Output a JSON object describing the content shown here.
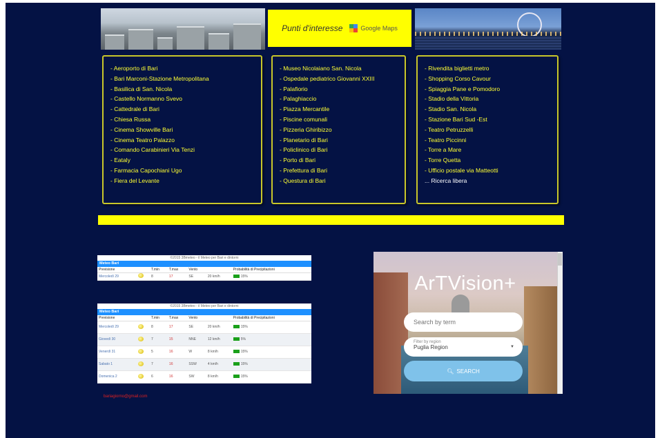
{
  "header": {
    "poi_title": "Punti d'interesse",
    "maps_label": "Google Maps"
  },
  "columns": [
    {
      "items": [
        "- Aeroporto di Bari",
        "- Bari Marconi-Stazione Metropolitana",
        "- Basilica di San. Nicola",
        "- Castello Normanno Svevo",
        "- Cattedrale di Bari",
        "- Chiesa Russa",
        "- Cinema Showville Bari",
        "- Cinema Teatro Palazzo",
        "- Comando Carabinieri Via Tenzi",
        "- Eataly",
        "- Farmacia Capochiani Ugo",
        "- Fiera del Levante"
      ]
    },
    {
      "items": [
        "- Museo Nicolaiano San. Nicola",
        "- Ospedale pediatrico Giovanni XXIII",
        "- Palafiorio",
        "- Palaghiaccio",
        "- Piazza Mercantile",
        "- Piscine comunali",
        "- Pizzeria Ghiribizzo",
        "- Planetario di Bari",
        "- Policlinico di Bari",
        "- Porto di Bari",
        "- Prefettura di Bari",
        "- Questura di Bari"
      ]
    },
    {
      "items": [
        "- Rivendita biglietti metro",
        "- Shopping Corso Cavour",
        "- Spiaggia Pane e Pomodoro",
        "- Stadio della Vittoria",
        "- Stadio San. Nicola",
        "- Stazione Bari Sud -Est",
        "- Teatro Petruzzelli",
        "- Teatro Piccinni",
        "- Torre a Mare",
        "- Torre Quetta",
        "- Ufficio postale via Matteotti"
      ],
      "free_search": "... Ricerca libera"
    }
  ],
  "meteo_small": {
    "credit": "©2015 3Bmeteo - il Meteo per Bari e dintorni",
    "title": "Meteo Bari",
    "headers": [
      "Previsione",
      "",
      "T.min",
      "T.max",
      "Vento",
      "",
      "Probabilità di Precipitazioni"
    ],
    "rows": [
      {
        "day": "Mercoledì 29",
        "tmin": "8",
        "tmax": "17",
        "wind_dir": "SE",
        "wind_speed": "20 km/h",
        "prob": "15%"
      }
    ]
  },
  "meteo_big": {
    "credit": "©2015 3Bmeteo - il Meteo per Bari e dintorni",
    "title": "Meteo Bari",
    "headers": [
      "Previsione",
      "",
      "T.min",
      "T.max",
      "Vento",
      "",
      "Probabilità di Precipitazioni"
    ],
    "rows": [
      {
        "day": "Mercoledì 29",
        "tmin": "8",
        "tmax": "17",
        "wind_dir": "SE",
        "wind_speed": "20 km/h",
        "prob": "15%"
      },
      {
        "day": "Giovedì 30",
        "tmin": "7",
        "tmax": "15",
        "wind_dir": "NNE",
        "wind_speed": "12 km/h",
        "prob": "5%"
      },
      {
        "day": "Venerdì 31",
        "tmin": "5",
        "tmax": "16",
        "wind_dir": "W",
        "wind_speed": "8 km/h",
        "prob": "15%"
      },
      {
        "day": "Sabato 1",
        "tmin": "7",
        "tmax": "16",
        "wind_dir": "SSW",
        "wind_speed": "4 km/h",
        "prob": "15%"
      },
      {
        "day": "Domenica 2",
        "tmin": "6",
        "tmax": "16",
        "wind_dir": "SW",
        "wind_speed": "8 km/h",
        "prob": "15%"
      }
    ]
  },
  "email": "bariagiorno@gmail.com",
  "artvision": {
    "title": "ArTVision+",
    "search_placeholder": "Search by term",
    "filter_label": "Filter by region",
    "filter_value": "Puglia Region",
    "search_button": "SEARCH"
  }
}
